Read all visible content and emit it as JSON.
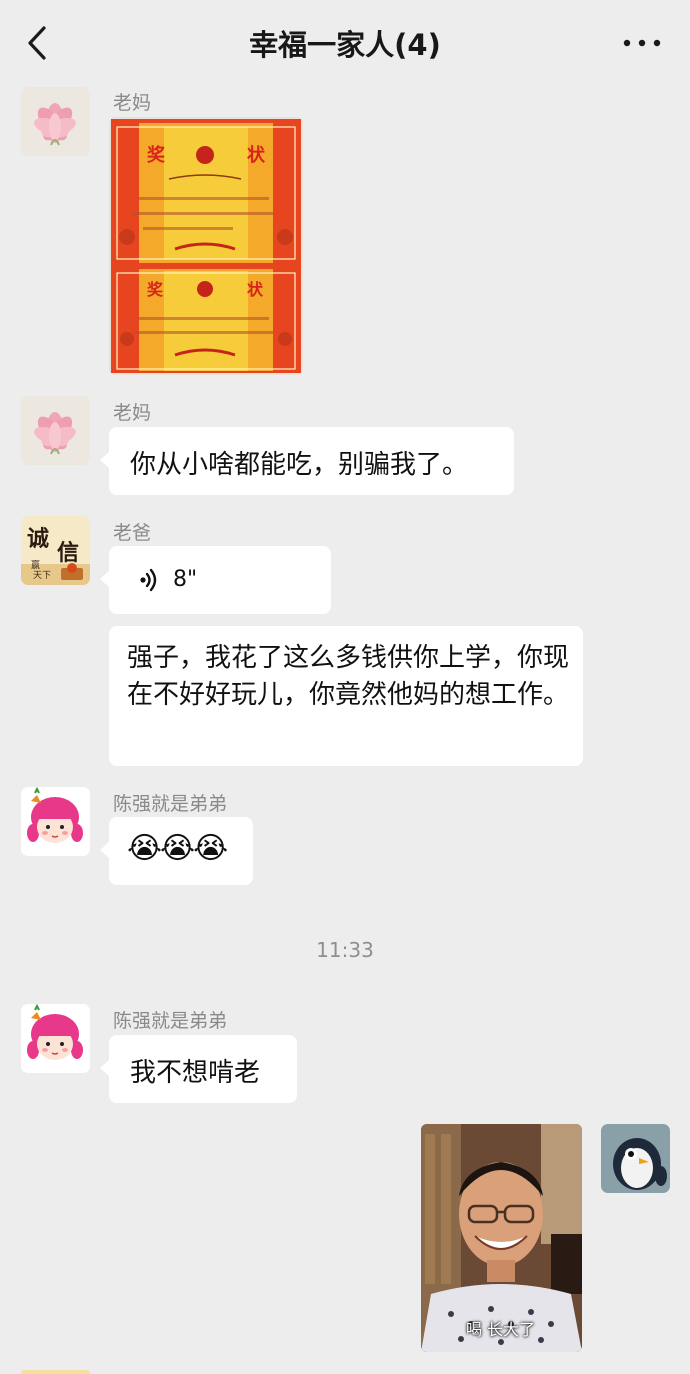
{
  "header": {
    "title": "幸福一家人(4)"
  },
  "messages": [
    {
      "sender": "老妈",
      "type": "image",
      "image_desc": "certificate-photo"
    },
    {
      "sender": "老妈",
      "type": "text",
      "text": "你从小啥都能吃，别骗我了。"
    },
    {
      "sender": "老爸",
      "type": "voice",
      "duration": "8\""
    },
    {
      "sender": "老爸",
      "type": "text",
      "text": "强子，我花了这么多钱供你上学，你现在不好好玩儿，你竟然他妈的想工作。"
    },
    {
      "sender": "陈强就是弟弟",
      "type": "emoji",
      "text": "😭😭😭"
    },
    {
      "sender": "陈强就是弟弟",
      "type": "text",
      "text": "我不想啃老"
    },
    {
      "sender": "me",
      "type": "image",
      "caption": "喝 长大了"
    }
  ],
  "timestamp": "11:33",
  "colors": {
    "background": "#ededed",
    "bubble": "#ffffff",
    "sender_text": "#8a8a8a"
  }
}
